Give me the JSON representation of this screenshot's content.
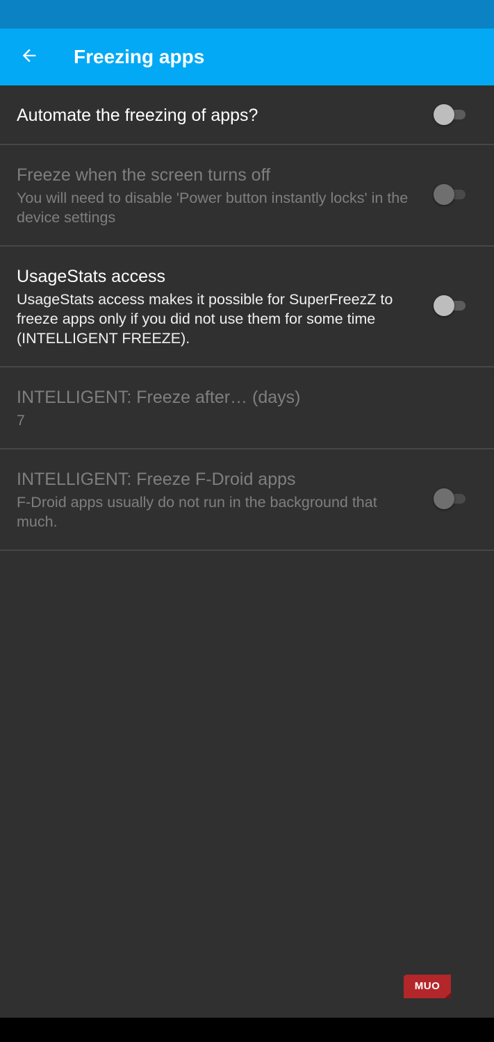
{
  "app_bar": {
    "title": "Freezing apps",
    "back_icon": "arrow-back-icon"
  },
  "colors": {
    "status_bar": "#0a82c4",
    "app_bar": "#03a9f4",
    "background": "#303030",
    "divider": "#474747",
    "watermark": "#b3262a"
  },
  "preferences": [
    {
      "title": "Automate the freezing of apps?",
      "summary": "",
      "enabled": true,
      "switch": false
    },
    {
      "title": "Freeze when the screen turns off",
      "summary": "You will need to disable 'Power button instantly locks' in the device settings",
      "enabled": false,
      "switch": false
    },
    {
      "title": "UsageStats access",
      "summary": "UsageStats access makes it possible for SuperFreezZ to freeze apps only if you did not use them for some time (INTELLIGENT FREEZE).",
      "enabled": true,
      "switch": false
    },
    {
      "title": "INTELLIGENT: Freeze after… (days)",
      "summary": "7",
      "enabled": false
    },
    {
      "title": "INTELLIGENT: Freeze F-Droid apps",
      "summary": "F-Droid apps usually do not run in the background that much.",
      "enabled": false,
      "switch": false
    }
  ],
  "watermark": {
    "text": "MUO"
  }
}
